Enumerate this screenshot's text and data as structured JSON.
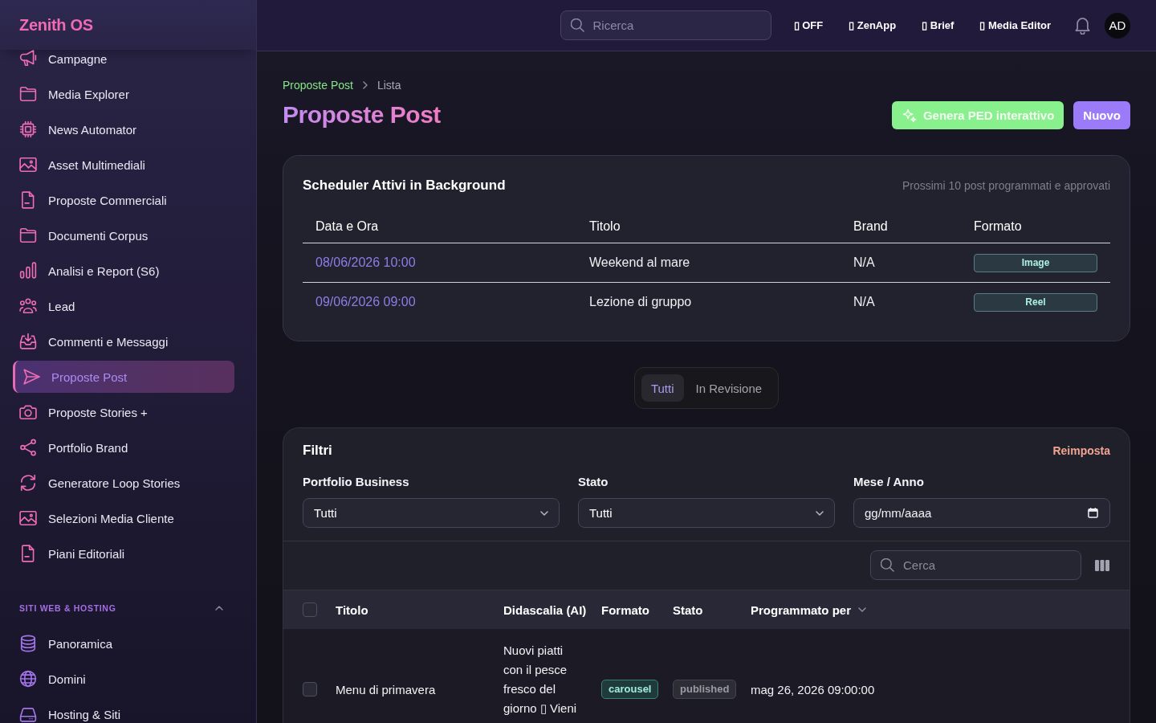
{
  "sidebar": {
    "logo": "Zenith OS",
    "items": [
      {
        "label": "Campagne",
        "selected": false
      },
      {
        "label": "Media Explorer",
        "selected": false
      },
      {
        "label": "News Automator",
        "selected": false
      },
      {
        "label": "Asset Multimediali",
        "selected": false
      },
      {
        "label": "Proposte Commerciali",
        "selected": false
      },
      {
        "label": "Documenti Corpus",
        "selected": false
      },
      {
        "label": "Analisi e Report (S6)",
        "selected": false
      },
      {
        "label": "Lead",
        "selected": false
      },
      {
        "label": "Commenti e Messaggi",
        "selected": false
      },
      {
        "label": "Proposte Post",
        "selected": true
      },
      {
        "label": "Proposte Stories +",
        "selected": false
      },
      {
        "label": "Portfolio Brand",
        "selected": false
      },
      {
        "label": "Generatore Loop Stories",
        "selected": false
      },
      {
        "label": "Selezioni Media Cliente",
        "selected": false
      },
      {
        "label": "Piani Editoriali",
        "selected": false
      }
    ],
    "sections": [
      {
        "title": "SITI WEB & HOSTING",
        "expanded": true,
        "items": [
          {
            "label": "Panoramica",
            "selected": false
          },
          {
            "label": "Domini",
            "selected": false
          },
          {
            "label": "Hosting & Siti",
            "selected": false
          }
        ]
      }
    ]
  },
  "topbar": {
    "search": {
      "placeholder": "Ricerca"
    },
    "links": [
      "▯ OFF",
      "▯ ZenApp",
      "▯ Brief",
      "▯ Media Editor"
    ],
    "avatar": "AD"
  },
  "breadcrumb": [
    "Proposte Post",
    "Lista"
  ],
  "page_title": "Proposte Post",
  "actions": [
    {
      "label": "Genera PED interattivo",
      "kind": "generate"
    },
    {
      "label": "Nuovo",
      "kind": "primary"
    }
  ],
  "scheduler": {
    "title": "Scheduler Attivi in Background",
    "subtitle": "Prossimi 10 post programmati e approvati",
    "columns": [
      "Data e Ora",
      "Titolo",
      "Brand",
      "Formato"
    ],
    "rows": [
      {
        "datetime": "08/06/2026 10:00",
        "title": "Weekend al mare",
        "brand": "N/A",
        "format": "Image"
      },
      {
        "datetime": "09/06/2026 09:00",
        "title": "Lezione di gruppo",
        "brand": "N/A",
        "format": "Reel"
      }
    ]
  },
  "view_tabs": [
    {
      "label": "Tutti",
      "selected": true
    },
    {
      "label": "In Revisione",
      "selected": false
    }
  ],
  "filters": {
    "title": "Filtri",
    "reset": "Reimposta",
    "fields": [
      {
        "label": "Portfolio Business",
        "kind": "select",
        "value": "Tutti"
      },
      {
        "label": "Stato",
        "kind": "select",
        "value": "Tutti"
      },
      {
        "label": "Mese / Anno",
        "kind": "date",
        "placeholder": "gg/mm/aaaa"
      }
    ]
  },
  "posts_table": {
    "search": {
      "placeholder": "Cerca"
    },
    "select_all": {
      "checked": false
    },
    "columns": [
      {
        "label": "Titolo",
        "sorted": false
      },
      {
        "label": "Didascalia (AI)",
        "sorted": false
      },
      {
        "label": "Formato",
        "sorted": false
      },
      {
        "label": "Stato",
        "sorted": false
      },
      {
        "label": "Programmato per",
        "sorted": true
      }
    ],
    "rows": [
      {
        "checked": false,
        "title": "Menu di primavera",
        "caption": "Nuovi piatti con il pesce fresco del giorno ▯ Vieni",
        "format": "carousel",
        "status": "published",
        "scheduled": "mag 26, 2026 09:00:00"
      }
    ]
  }
}
